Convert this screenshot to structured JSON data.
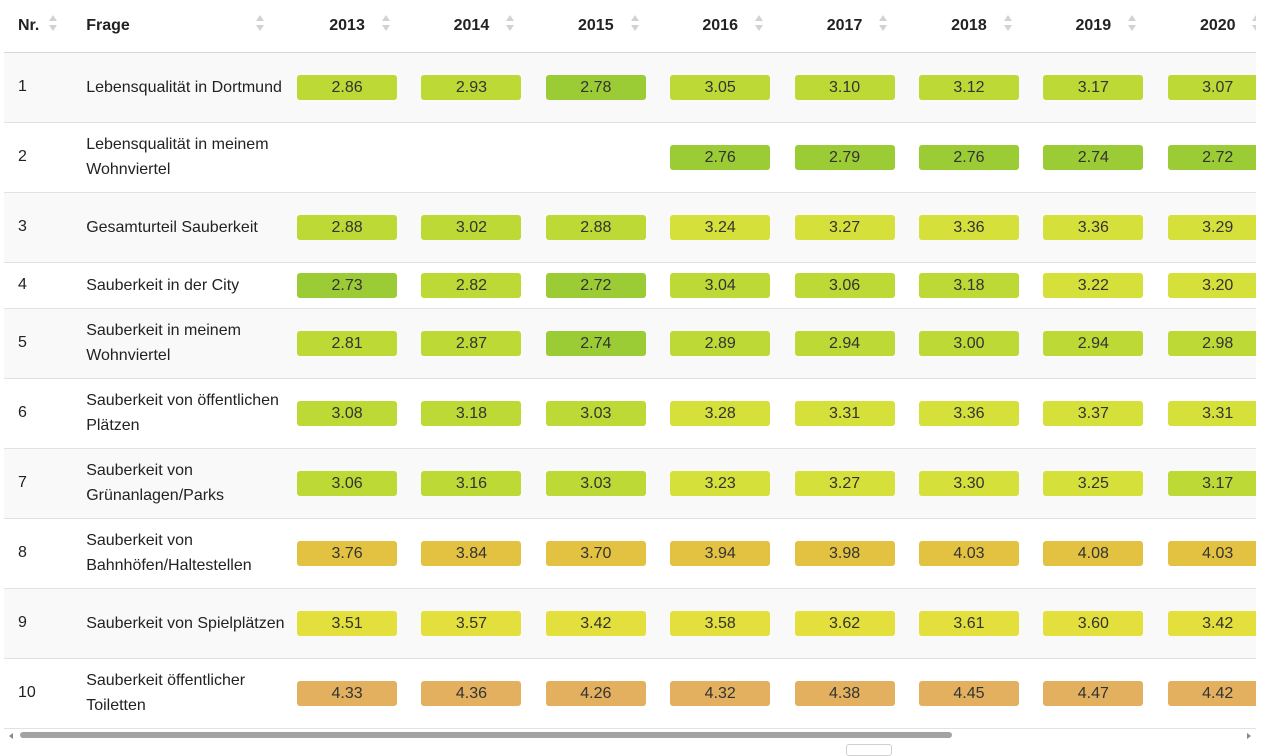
{
  "table": {
    "headers": {
      "nr": "Nr.",
      "frage": "Frage",
      "years": [
        "2013",
        "2014",
        "2015",
        "2016",
        "2017",
        "2018",
        "2019",
        "2020"
      ]
    },
    "rows": [
      {
        "nr": "1",
        "frage": "Lebensqualität in Dortmund",
        "values": [
          "2.86",
          "2.93",
          "2.78",
          "3.05",
          "3.10",
          "3.12",
          "3.17",
          "3.07"
        ]
      },
      {
        "nr": "2",
        "frage": "Lebensqualität in meinem Wohnviertel",
        "values": [
          "",
          "",
          "",
          "2.76",
          "2.79",
          "2.76",
          "2.74",
          "2.72"
        ]
      },
      {
        "nr": "3",
        "frage": "Gesamturteil Sauberkeit",
        "values": [
          "2.88",
          "3.02",
          "2.88",
          "3.24",
          "3.27",
          "3.36",
          "3.36",
          "3.29"
        ]
      },
      {
        "nr": "4",
        "frage": "Sauberkeit in der City",
        "values": [
          "2.73",
          "2.82",
          "2.72",
          "3.04",
          "3.06",
          "3.18",
          "3.22",
          "3.20"
        ]
      },
      {
        "nr": "5",
        "frage": "Sauberkeit in meinem Wohnviertel",
        "values": [
          "2.81",
          "2.87",
          "2.74",
          "2.89",
          "2.94",
          "3.00",
          "2.94",
          "2.98"
        ]
      },
      {
        "nr": "6",
        "frage": "Sauberkeit von öffentlichen Plätzen",
        "values": [
          "3.08",
          "3.18",
          "3.03",
          "3.28",
          "3.31",
          "3.36",
          "3.37",
          "3.31"
        ]
      },
      {
        "nr": "7",
        "frage": "Sauberkeit von Grünanlagen/Parks",
        "values": [
          "3.06",
          "3.16",
          "3.03",
          "3.23",
          "3.27",
          "3.30",
          "3.25",
          "3.17"
        ]
      },
      {
        "nr": "8",
        "frage": "Sauberkeit von Bahnhöfen/Haltestellen",
        "values": [
          "3.76",
          "3.84",
          "3.70",
          "3.94",
          "3.98",
          "4.03",
          "4.08",
          "4.03"
        ]
      },
      {
        "nr": "9",
        "frage": "Sauberkeit von Spielplätzen",
        "values": [
          "3.51",
          "3.57",
          "3.42",
          "3.58",
          "3.62",
          "3.61",
          "3.60",
          "3.42"
        ]
      },
      {
        "nr": "10",
        "frage": "Sauberkeit öffentlicher Toiletten",
        "values": [
          "4.33",
          "4.36",
          "4.26",
          "4.32",
          "4.38",
          "4.45",
          "4.47",
          "4.42"
        ]
      }
    ]
  },
  "icons": {
    "sort": "sort-icon",
    "scroll_left": "scroll-left-arrow-icon",
    "scroll_right": "scroll-right-arrow-icon"
  },
  "scrollbar": {
    "position": 0.0,
    "visible_fraction": 0.74
  },
  "colors": {
    "green_dark": "#9ccc35",
    "green_light": "#bcd935",
    "yellow_green": "#d6e03a",
    "yellow": "#e3df3c",
    "gold": "#e3c242",
    "orange": "#e3b05f",
    "header_border": "#d8d8d8",
    "row_border": "#e2e2e2"
  }
}
